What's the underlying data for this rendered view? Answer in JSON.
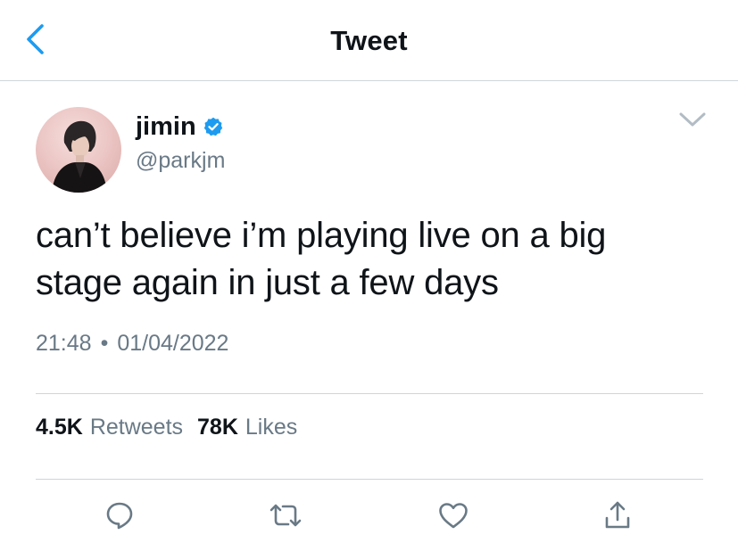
{
  "header": {
    "title": "Tweet",
    "back_icon": "chevron-left-icon"
  },
  "tweet": {
    "author": {
      "name": "jimin",
      "handle": "@parkjm",
      "verified": true
    },
    "text": "can’t believe i’m playing live on a big stage again in just a few days",
    "time": "21:48",
    "separator": "•",
    "date": "01/04/2022",
    "stats": {
      "retweets_count": "4.5K",
      "retweets_label": "Retweets",
      "likes_count": "78K",
      "likes_label": "Likes"
    }
  },
  "actions": [
    {
      "name": "reply",
      "icon": "speech-bubble-icon"
    },
    {
      "name": "retweet",
      "icon": "retweet-icon"
    },
    {
      "name": "like",
      "icon": "heart-icon"
    },
    {
      "name": "share",
      "icon": "share-icon"
    }
  ],
  "colors": {
    "accent": "#1d9bf0",
    "text_primary": "#0f1419",
    "text_secondary": "#697986",
    "divider": "#cfd5da",
    "icon_gray": "#697986"
  }
}
